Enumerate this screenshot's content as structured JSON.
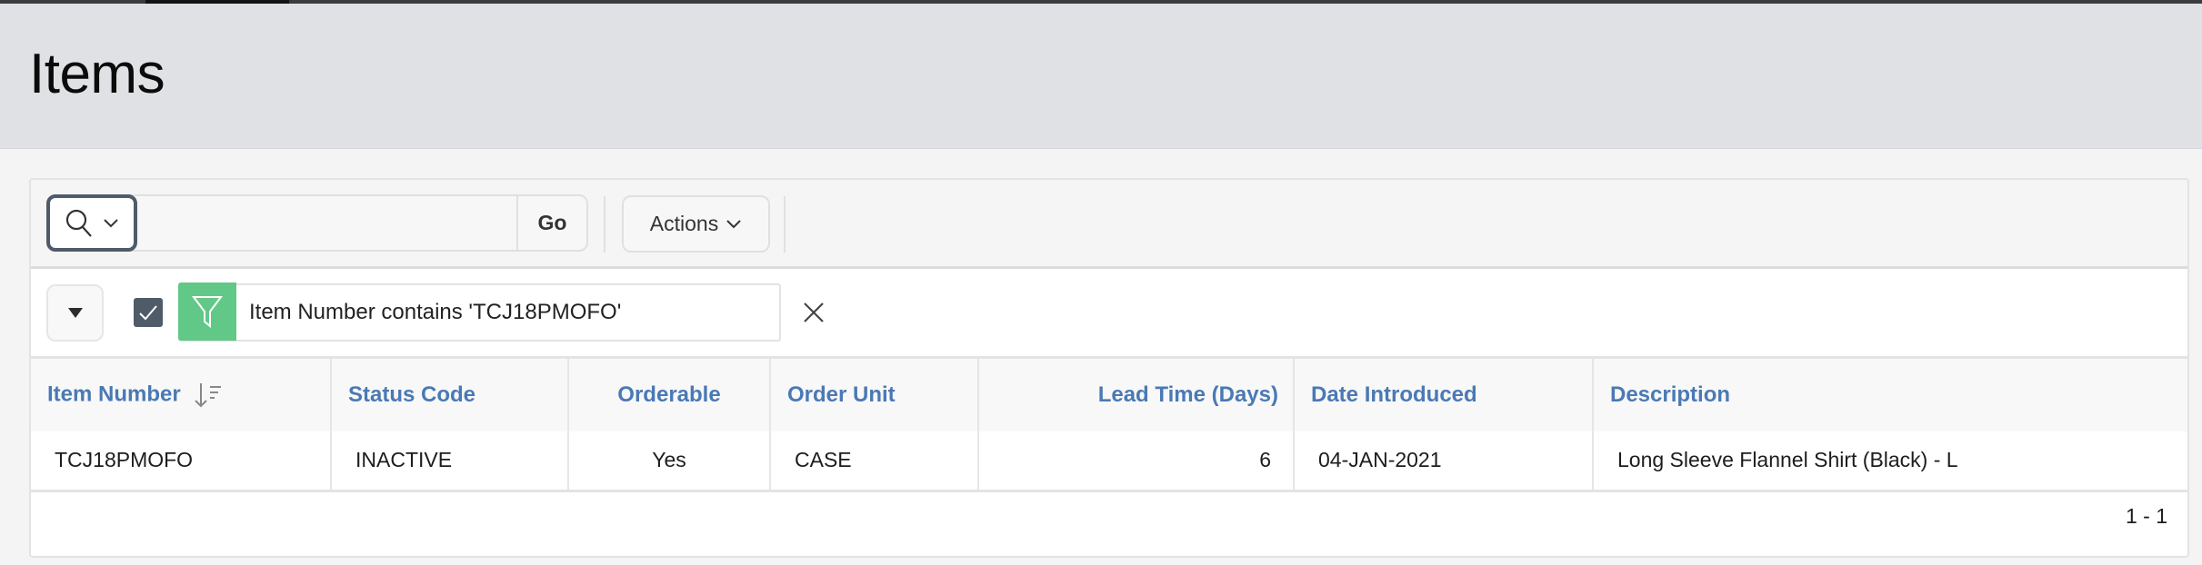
{
  "page": {
    "title": "Items"
  },
  "toolbar": {
    "search_toggle_icon": "search-icon",
    "search_value": "",
    "search_placeholder": "",
    "go_label": "Go",
    "actions_label": "Actions"
  },
  "filter": {
    "enabled": true,
    "icon": "filter-icon",
    "text": "Item Number contains 'TCJ18PMOFO'"
  },
  "table": {
    "columns": [
      {
        "label": "Item Number",
        "sorted": "descending"
      },
      {
        "label": "Status Code"
      },
      {
        "label": "Orderable"
      },
      {
        "label": "Order Unit"
      },
      {
        "label": "Lead Time (Days)"
      },
      {
        "label": "Date Introduced"
      },
      {
        "label": "Description"
      }
    ],
    "rows": [
      {
        "item_number": "TCJ18PMOFO",
        "status_code": "INACTIVE",
        "orderable": "Yes",
        "order_unit": "CASE",
        "lead_time": "6",
        "date_introduced": "04-JAN-2021",
        "description": "Long Sleeve Flannel Shirt (Black) - L"
      }
    ]
  },
  "pagination": {
    "range": "1 - 1"
  },
  "colors": {
    "header_link": "#4a79b5",
    "filter_green": "#62c887",
    "control_dark": "#4f5b69"
  }
}
